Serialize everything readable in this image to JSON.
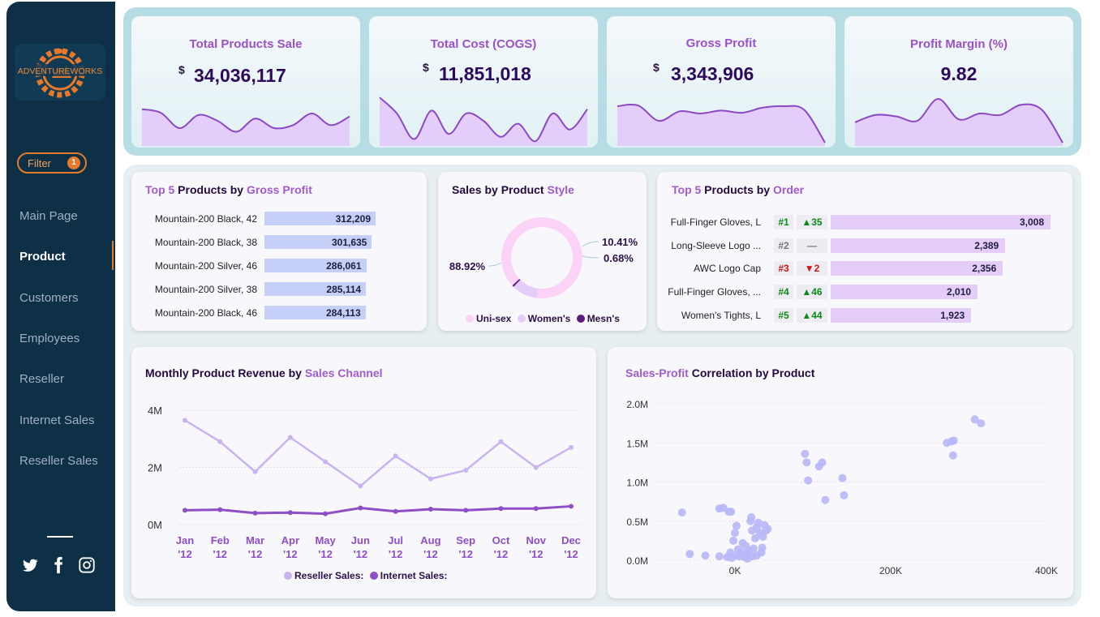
{
  "brand": {
    "name": "ADVENTUREWORKS",
    "accent": "#e67a2a",
    "sidebar_bg": "#0e3047"
  },
  "filter": {
    "label": "Filter",
    "count": "1"
  },
  "nav": [
    {
      "label": "Main Page",
      "active": false
    },
    {
      "label": "Product",
      "active": true
    },
    {
      "label": "Customers",
      "active": false
    },
    {
      "label": "Employees",
      "active": false
    },
    {
      "label": "Reseller",
      "active": false
    },
    {
      "label": "Internet Sales",
      "active": false
    },
    {
      "label": "Reseller Sales",
      "active": false
    }
  ],
  "social": [
    "twitter-icon",
    "facebook-icon",
    "instagram-icon"
  ],
  "kpis": [
    {
      "title": "Total Products Sale",
      "currency": "$",
      "value": "34,036,117"
    },
    {
      "title": "Total Cost (COGS)",
      "currency": "$",
      "value": "11,851,018"
    },
    {
      "title": "Gross Profit",
      "currency": "$",
      "value": "3,343,906"
    },
    {
      "title": "Profit Margin (%)",
      "currency": "",
      "value": "9.82"
    }
  ],
  "top5_gross_profit": {
    "title_parts": [
      "Top 5",
      " Products by ",
      "Gross Profit"
    ],
    "rows": [
      {
        "name": "Mountain-200 Black, 42",
        "value": 312209,
        "label": "312,209"
      },
      {
        "name": "Mountain-200 Black, 38",
        "value": 301635,
        "label": "301,635"
      },
      {
        "name": "Mountain-200 Silver, 46",
        "value": 286061,
        "label": "286,061"
      },
      {
        "name": "Mountain-200 Silver, 38",
        "value": 285114,
        "label": "285,114"
      },
      {
        "name": "Mountain-200 Black, 46",
        "value": 284113,
        "label": "284,113"
      }
    ]
  },
  "sales_by_style": {
    "title_parts": [
      "Sales by Product ",
      "Style"
    ],
    "slices": [
      {
        "name": "Uni-sex",
        "value": 88.92,
        "label": "88.92%",
        "color": "#fbd3f7"
      },
      {
        "name": "Women's",
        "value": 10.41,
        "label": "10.41%",
        "color": "#e5cdf9"
      },
      {
        "name": "Mesn's",
        "value": 0.68,
        "label": "0.68%",
        "color": "#5a1a80"
      }
    ]
  },
  "top5_order": {
    "title_parts": [
      "Top 5",
      " Products by ",
      "Order"
    ],
    "rows": [
      {
        "name": "Full-Finger Gloves, L",
        "rank": "#1",
        "change": "▲35",
        "trend": "up",
        "value": 3008,
        "label": "3,008"
      },
      {
        "name": "Long-Sleeve Logo ...",
        "rank": "#2",
        "change": "—",
        "trend": "flat",
        "value": 2389,
        "label": "2,389"
      },
      {
        "name": "AWC Logo Cap",
        "rank": "#3",
        "change": "▼2",
        "trend": "down",
        "value": 2356,
        "label": "2,356"
      },
      {
        "name": "Full-Finger Gloves, ...",
        "rank": "#4",
        "change": "▲46",
        "trend": "up",
        "value": 2010,
        "label": "2,010"
      },
      {
        "name": "Women's Tights, L",
        "rank": "#5",
        "change": "▲44",
        "trend": "up",
        "value": 1923,
        "label": "1,923"
      }
    ]
  },
  "monthly_revenue": {
    "title_parts": [
      "Monthly Product Revenue by ",
      "Sales Channel"
    ],
    "legend": [
      "Reseller Sales:",
      "Internet Sales:"
    ]
  },
  "correlation": {
    "title_parts": [
      "Sales-Profit",
      " Correlation by Product"
    ]
  },
  "chart_data": [
    {
      "type": "area",
      "name": "kpi-sparklines",
      "series": [
        {
          "values": [
            46,
            41,
            20,
            38,
            30,
            15,
            33,
            20,
            24,
            40,
            24,
            36
          ]
        },
        {
          "values": [
            62,
            40,
            5,
            44,
            12,
            40,
            30,
            8,
            26,
            2,
            40,
            18,
            46
          ]
        },
        {
          "values": [
            50,
            51,
            30,
            43,
            40,
            44,
            41,
            48,
            50,
            45,
            0
          ]
        },
        {
          "values": [
            28,
            38,
            36,
            30,
            60,
            32,
            40,
            38,
            52,
            45,
            0
          ]
        }
      ]
    },
    {
      "type": "line",
      "title": "Monthly Product Revenue by Sales Channel",
      "categories": [
        "Jan '12",
        "Feb '12",
        "Mar '12",
        "Apr '12",
        "May '12",
        "Jun '12",
        "Jul '12",
        "Aug '12",
        "Sep '12",
        "Oct '12",
        "Nov '12",
        "Dec '12"
      ],
      "y_ticks": [
        "0M",
        "2M",
        "4M"
      ],
      "ylim": [
        0,
        4.2
      ],
      "series": [
        {
          "name": "Reseller Sales:",
          "color": "#c9b3f0",
          "values": [
            3.65,
            2.9,
            1.85,
            3.05,
            2.2,
            1.35,
            2.4,
            1.6,
            1.9,
            2.9,
            2.0,
            2.7
          ]
        },
        {
          "name": "Internet Sales:",
          "color": "#8e4ec6",
          "values": [
            0.5,
            0.52,
            0.4,
            0.42,
            0.38,
            0.58,
            0.46,
            0.54,
            0.5,
            0.56,
            0.56,
            0.64
          ]
        }
      ]
    },
    {
      "type": "scatter",
      "title": "Sales-Profit Correlation by Product",
      "x_ticks": [
        "0K",
        "200K",
        "400K"
      ],
      "y_ticks": [
        "0.0M",
        "0.5M",
        "1.0M",
        "1.5M",
        "2.0M"
      ],
      "xlim": [
        -70,
        400
      ],
      "ylim": [
        0,
        2.0
      ],
      "color": "#b8b7f7",
      "points": [
        [
          -68,
          0.61
        ],
        [
          -58,
          0.08
        ],
        [
          -38,
          0.06
        ],
        [
          -20,
          0.05
        ],
        [
          -20,
          0.66
        ],
        [
          -15,
          0.67
        ],
        [
          -8,
          0.62
        ],
        [
          -5,
          0.62
        ],
        [
          0,
          0.35
        ],
        [
          2,
          0.44
        ],
        [
          -2,
          0.25
        ],
        [
          4,
          0.14
        ],
        [
          6,
          0.05
        ],
        [
          8,
          0.1
        ],
        [
          10,
          0.22
        ],
        [
          12,
          0.04
        ],
        [
          14,
          0.18
        ],
        [
          15,
          0.08
        ],
        [
          16,
          0.02
        ],
        [
          18,
          0.12
        ],
        [
          -6,
          0.1
        ],
        [
          -10,
          0.04
        ],
        [
          -4,
          0.03
        ],
        [
          2,
          0.06
        ],
        [
          20,
          0.5
        ],
        [
          21,
          0.55
        ],
        [
          22,
          0.38
        ],
        [
          24,
          0.15
        ],
        [
          26,
          0.28
        ],
        [
          28,
          0.42
        ],
        [
          30,
          0.48
        ],
        [
          32,
          0.35
        ],
        [
          34,
          0.1
        ],
        [
          35,
          0.16
        ],
        [
          36,
          0.3
        ],
        [
          38,
          0.45
        ],
        [
          40,
          0.38
        ],
        [
          42,
          0.4
        ],
        [
          22,
          0.05
        ],
        [
          28,
          0.06
        ],
        [
          90,
          1.36
        ],
        [
          92,
          1.25
        ],
        [
          94,
          1.02
        ],
        [
          108,
          1.2
        ],
        [
          112,
          1.25
        ],
        [
          116,
          0.77
        ],
        [
          138,
          1.05
        ],
        [
          140,
          0.83
        ],
        [
          272,
          1.5
        ],
        [
          278,
          1.52
        ],
        [
          281,
          1.53
        ],
        [
          280,
          1.34
        ],
        [
          308,
          1.8
        ],
        [
          316,
          1.75
        ]
      ]
    },
    {
      "type": "pie",
      "title": "Sales by Product Style",
      "categories": [
        "Uni-sex",
        "Women's",
        "Mesn's"
      ],
      "values": [
        88.92,
        10.41,
        0.68
      ]
    },
    {
      "type": "bar",
      "title": "Top 5 Products by Gross Profit",
      "categories": [
        "Mountain-200 Black, 42",
        "Mountain-200 Black, 38",
        "Mountain-200 Silver, 46",
        "Mountain-200 Silver, 38",
        "Mountain-200 Black, 46"
      ],
      "values": [
        312209,
        301635,
        286061,
        285114,
        284113
      ]
    },
    {
      "type": "bar",
      "title": "Top 5 Products by Order",
      "categories": [
        "Full-Finger Gloves, L",
        "Long-Sleeve Logo ...",
        "AWC Logo Cap",
        "Full-Finger Gloves, ...",
        "Women's Tights, L"
      ],
      "values": [
        3008,
        2389,
        2356,
        2010,
        1923
      ]
    }
  ]
}
